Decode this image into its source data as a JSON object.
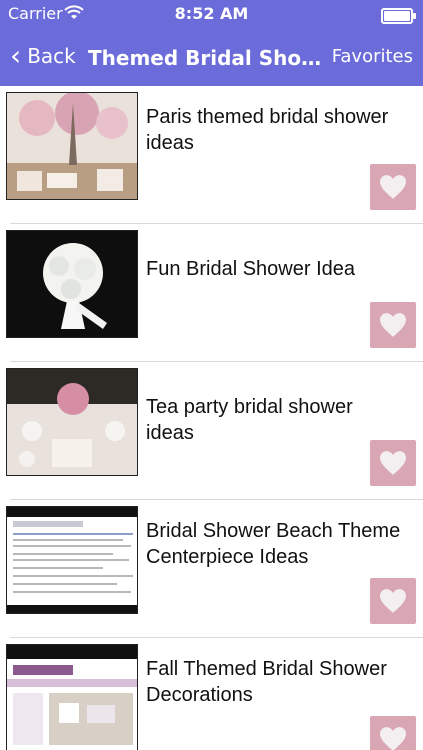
{
  "status_bar": {
    "carrier": "Carrier",
    "time": "8:52 AM"
  },
  "nav": {
    "back_label": "Back",
    "title": "Themed Bridal Shower Ide...",
    "favorites_label": "Favorites"
  },
  "items": [
    {
      "title": "Paris themed bridal shower ideas",
      "image": "paris-shower-photo"
    },
    {
      "title": "Fun Bridal Shower Idea",
      "image": "bouquet-photo"
    },
    {
      "title": "Tea party bridal shower ideas",
      "image": "tea-party-table-photo"
    },
    {
      "title": "Bridal Shower Beach Theme Centerpiece Ideas",
      "image": "beach-centerpiece-webpage-screenshot"
    },
    {
      "title": "Fall Themed Bridal Shower Decorations",
      "image": "favormart-webpage-screenshot"
    }
  ],
  "colors": {
    "nav_bg": "#6b6bd9",
    "heart_bg": "#d9a7b3"
  },
  "icons": {
    "back": "chevron-left-icon",
    "favorite": "heart-icon",
    "wifi": "wifi-icon",
    "battery": "battery-icon"
  }
}
